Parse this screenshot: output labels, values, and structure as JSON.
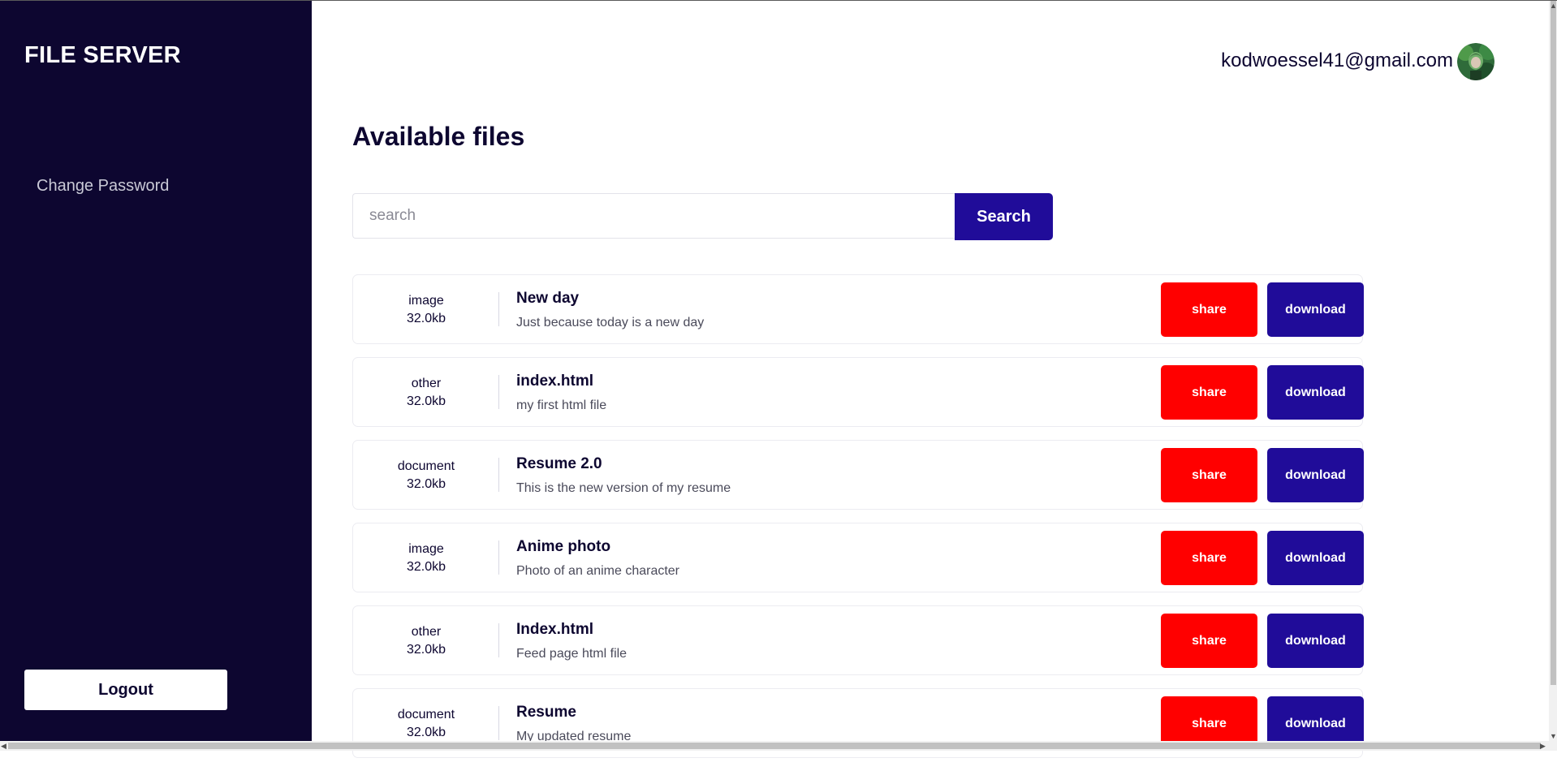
{
  "app": {
    "brand": "FILE SERVER"
  },
  "sidebar": {
    "items": [
      {
        "label": "Change Password"
      }
    ],
    "logout_label": "Logout"
  },
  "header": {
    "user_email": "kodwoessel41@gmail.com"
  },
  "main": {
    "title": "Available files",
    "search": {
      "placeholder": "search",
      "value": "",
      "button_label": "Search"
    },
    "files": [
      {
        "type": "image",
        "size": "32.0kb",
        "title": "New day",
        "description": "Just because today is a new day",
        "share_label": "share",
        "download_label": "download"
      },
      {
        "type": "other",
        "size": "32.0kb",
        "title": "index.html",
        "description": "my first html file",
        "share_label": "share",
        "download_label": "download"
      },
      {
        "type": "document",
        "size": "32.0kb",
        "title": "Resume 2.0",
        "description": "This is the new version of my resume",
        "share_label": "share",
        "download_label": "download"
      },
      {
        "type": "image",
        "size": "32.0kb",
        "title": "Anime photo",
        "description": "Photo of an anime character",
        "share_label": "share",
        "download_label": "download"
      },
      {
        "type": "other",
        "size": "32.0kb",
        "title": "Index.html",
        "description": "Feed page html file",
        "share_label": "share",
        "download_label": "download"
      },
      {
        "type": "document",
        "size": "32.0kb",
        "title": "Resume",
        "description": "My updated resume",
        "share_label": "share",
        "download_label": "download"
      }
    ]
  },
  "colors": {
    "sidebar_bg": "#0d0630",
    "primary": "#200c99",
    "danger": "#ff0000",
    "text": "#0d0630"
  },
  "icons": {
    "avatar": "user-avatar-icon"
  }
}
